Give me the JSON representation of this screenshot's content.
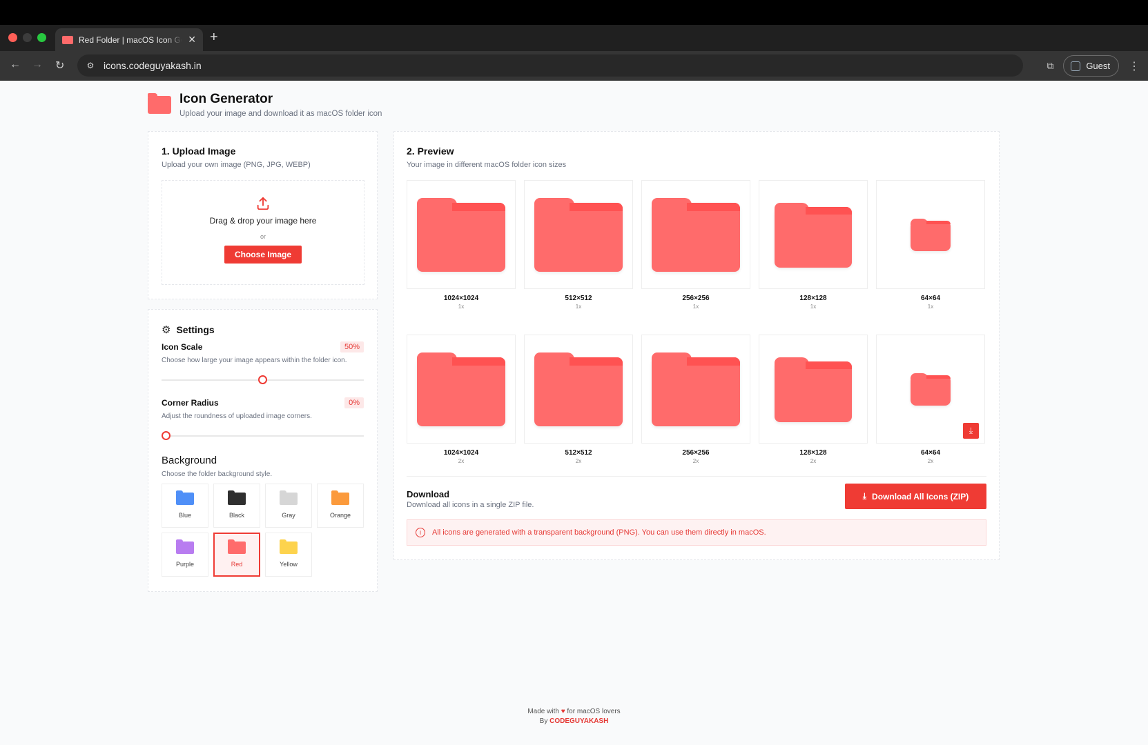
{
  "browser": {
    "tab_title": "Red Folder | macOS Icon Generator",
    "url": "icons.codeguyakash.in",
    "profile_label": "Guest"
  },
  "header": {
    "title": "Icon Generator",
    "subtitle": "Upload your image and download it as macOS folder icon"
  },
  "upload": {
    "title": "1. Upload Image",
    "subtitle": "Upload your own image (PNG, JPG, WEBP)",
    "drop_text": "Drag & drop your image here",
    "or_text": "or",
    "button_label": "Choose Image"
  },
  "settings": {
    "title": "Settings",
    "icon_scale": {
      "label": "Icon Scale",
      "value": "50%",
      "help": "Choose how large your image appears within the folder icon.",
      "fraction": 0.5
    },
    "corner_radius": {
      "label": "Corner Radius",
      "value": "0%",
      "help": "Adjust the roundness of uploaded image corners.",
      "fraction": 0.0
    },
    "background": {
      "title": "Background",
      "help": "Choose the folder background style.",
      "options": [
        {
          "label": "Blue",
          "color": "#4f8ff7"
        },
        {
          "label": "Black",
          "color": "#2f2f2f"
        },
        {
          "label": "Gray",
          "color": "#d6d6d6"
        },
        {
          "label": "Orange",
          "color": "#fb9a3c"
        },
        {
          "label": "Purple",
          "color": "#b87cf0"
        },
        {
          "label": "Red",
          "color": "#ff6b6b",
          "selected": true
        },
        {
          "label": "Yellow",
          "color": "#fdd34d"
        }
      ]
    }
  },
  "preview": {
    "title": "2. Preview",
    "subtitle": "Your image in different macOS folder icon sizes",
    "items": [
      {
        "size": "1024×1024",
        "scale": "1x"
      },
      {
        "size": "512×512",
        "scale": "1x"
      },
      {
        "size": "256×256",
        "scale": "1x"
      },
      {
        "size": "128×128",
        "scale": "1x"
      },
      {
        "size": "64×64",
        "scale": "1x"
      },
      {
        "size": "1024×1024",
        "scale": "2x"
      },
      {
        "size": "512×512",
        "scale": "2x"
      },
      {
        "size": "256×256",
        "scale": "2x"
      },
      {
        "size": "128×128",
        "scale": "2x"
      },
      {
        "size": "64×64",
        "scale": "2x"
      }
    ]
  },
  "download": {
    "title": "Download",
    "subtitle": "Download all icons in a single ZIP file.",
    "button_label": "Download All Icons (ZIP)",
    "note": "All icons are generated with a transparent background (PNG). You can use them directly in macOS."
  },
  "footer": {
    "made_with_prefix": "Made with",
    "made_with_suffix": "for macOS lovers",
    "by_prefix": "By",
    "brand": "CODEGUYAKASH"
  },
  "colors": {
    "accent": "#ef3b34",
    "folder": "#ff6b6b"
  }
}
